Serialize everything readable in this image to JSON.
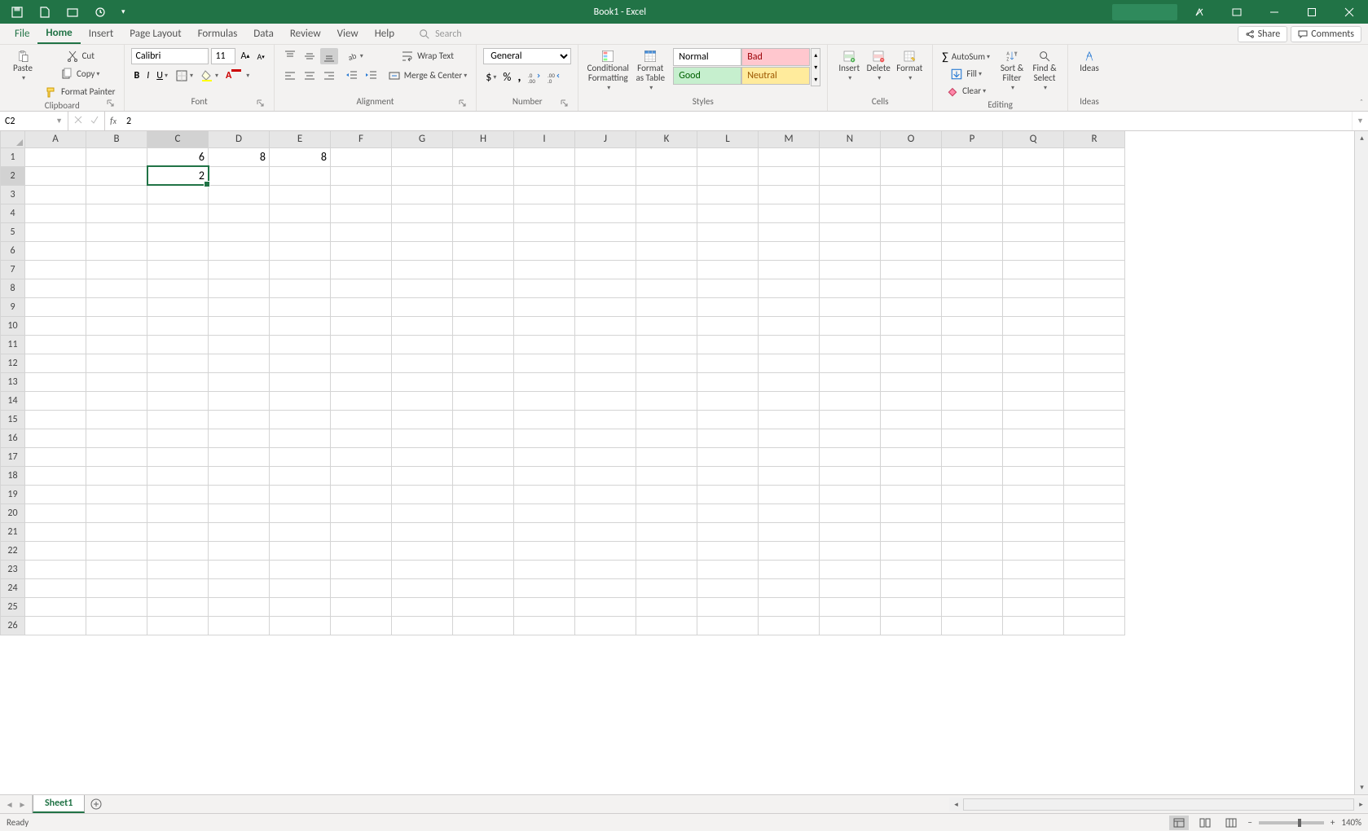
{
  "title": "Book1 - Excel",
  "qat": {
    "items": [
      "save",
      "new",
      "open",
      "autosave",
      "more"
    ]
  },
  "tabs": {
    "file": "File",
    "items": [
      "Home",
      "Insert",
      "Page Layout",
      "Formulas",
      "Data",
      "Review",
      "View",
      "Help"
    ],
    "active": "Home",
    "search_placeholder": "Search",
    "share": "Share",
    "comments": "Comments"
  },
  "ribbon": {
    "clipboard": {
      "label": "Clipboard",
      "paste": "Paste",
      "cut": "Cut",
      "copy": "Copy",
      "format_painter": "Format Painter"
    },
    "font": {
      "label": "Font",
      "name": "Calibri",
      "size": "11"
    },
    "alignment": {
      "label": "Alignment",
      "wrap": "Wrap Text",
      "merge": "Merge & Center"
    },
    "number": {
      "label": "Number",
      "format": "General"
    },
    "styles": {
      "label": "Styles",
      "cond": "Conditional Formatting",
      "table": "Format as Table",
      "items": [
        "Normal",
        "Bad",
        "Good",
        "Neutral"
      ]
    },
    "cells": {
      "label": "Cells",
      "insert": "Insert",
      "delete": "Delete",
      "format": "Format"
    },
    "editing": {
      "label": "Editing",
      "autosum": "AutoSum",
      "fill": "Fill",
      "clear": "Clear",
      "sort": "Sort & Filter",
      "find": "Find & Select"
    },
    "ideas": {
      "label": "Ideas",
      "btn": "Ideas"
    }
  },
  "formula_bar": {
    "name_box": "C2",
    "value": "2"
  },
  "grid": {
    "columns": [
      "A",
      "B",
      "C",
      "D",
      "E",
      "F",
      "G",
      "H",
      "I",
      "J",
      "K",
      "L",
      "M",
      "N",
      "O",
      "P",
      "Q",
      "R"
    ],
    "rows": 26,
    "selected": {
      "col": "C",
      "row": 2
    },
    "cells": {
      "C1": "6",
      "D1": "8",
      "E1": "8",
      "C2": "2"
    }
  },
  "sheets": {
    "active": "Sheet1"
  },
  "status": {
    "ready": "Ready",
    "zoom": "140%"
  }
}
